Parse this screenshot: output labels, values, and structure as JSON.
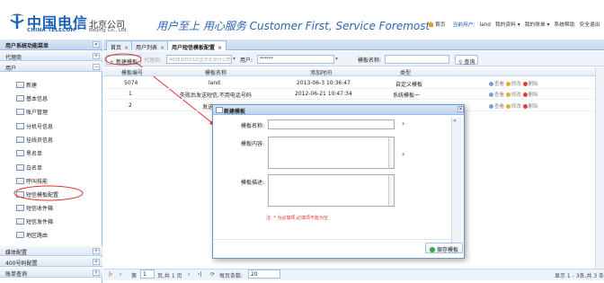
{
  "header": {
    "logo_cn": "中国电信",
    "logo_en": "CHINA TELECOM",
    "company_cn": "北京公司",
    "company_en": "Beijing Co., Ltd.",
    "slogan": "用户至上 用心服务 Customer First, Service Foremost",
    "links": {
      "home": "首页",
      "current_user_label": "当前用户:",
      "current_user": "land",
      "my_profile": "我的资料 ▾",
      "my_account": "我的账单 ▾",
      "help": "系统帮助",
      "logout": "安全退出"
    }
  },
  "sidebar": {
    "title": "用户系统功能菜单",
    "groups_top": [
      {
        "label": "代理商",
        "btn": "+"
      },
      {
        "label": "用户",
        "btn": "−"
      }
    ],
    "items": [
      {
        "label": "新建"
      },
      {
        "label": "基本信息"
      },
      {
        "label": "账户管理"
      },
      {
        "label": "分机号信息"
      },
      {
        "label": "挂线员信息"
      },
      {
        "label": "黑名单"
      },
      {
        "label": "白名单"
      },
      {
        "label": "呼叫技能"
      },
      {
        "label": "短信模板配置"
      },
      {
        "label": "短信收件箱"
      },
      {
        "label": "短信发件箱"
      },
      {
        "label": "地区路由"
      }
    ],
    "groups_bottom": [
      {
        "label": "媒体配置",
        "btn": "+"
      },
      {
        "label": "400号码配置",
        "btn": "+"
      },
      {
        "label": "账单查询",
        "btn": "+"
      }
    ]
  },
  "tabs": [
    {
      "label": "首页",
      "close": "×"
    },
    {
      "label": "用户列表",
      "close": "×"
    },
    {
      "label": "用户短信模板配置",
      "close": "×"
    }
  ],
  "toolbar": {
    "new_btn": "新建模板",
    "agent_label": "代理商:",
    "agent_value": "4008105012(显示北京分公司...)",
    "user_label": "用户:",
    "user_value": "******",
    "template_name_label": "模板名称:",
    "template_name_value": "",
    "search_btn": "查询"
  },
  "grid": {
    "columns": [
      "模板编号",
      "模板名称",
      "添加时间",
      "类型"
    ],
    "rows": [
      {
        "id": "5074",
        "name": "land",
        "time": "2013-06-3 10:36:47",
        "type": "自定义模板"
      },
      {
        "id": "1",
        "name": "失败后发送短信,不用电话号码",
        "time": "2012-06-21 10:47:34",
        "type": "系统模板一"
      },
      {
        "id": "2",
        "name": "发送...",
        "time": "",
        "type": ""
      }
    ],
    "row_actions": {
      "view": "查看",
      "edit": "修改",
      "delete": "删除"
    }
  },
  "modal": {
    "title": "新建模板",
    "close": "×",
    "name_label": "模板名称:",
    "content_label": "模板内容:",
    "desc_label": "模板描述:",
    "required": "*",
    "note": "注: * 为必填项,必填项不能为空",
    "save_btn": "保存模板"
  },
  "pager": {
    "first": "|‹",
    "prev": "‹",
    "page_label": "第",
    "page_value": "1",
    "page_total": "页,共 1 页",
    "next": "›",
    "last": "›|",
    "refresh": "⟳",
    "per_page_label": "每页条数:",
    "per_page_value": "20",
    "summary": "显示 1 - 3条,共 3 条"
  },
  "colors": {
    "brand": "#1a5fb4",
    "panel_border": "#99bbe8",
    "annotation": "#d33"
  }
}
